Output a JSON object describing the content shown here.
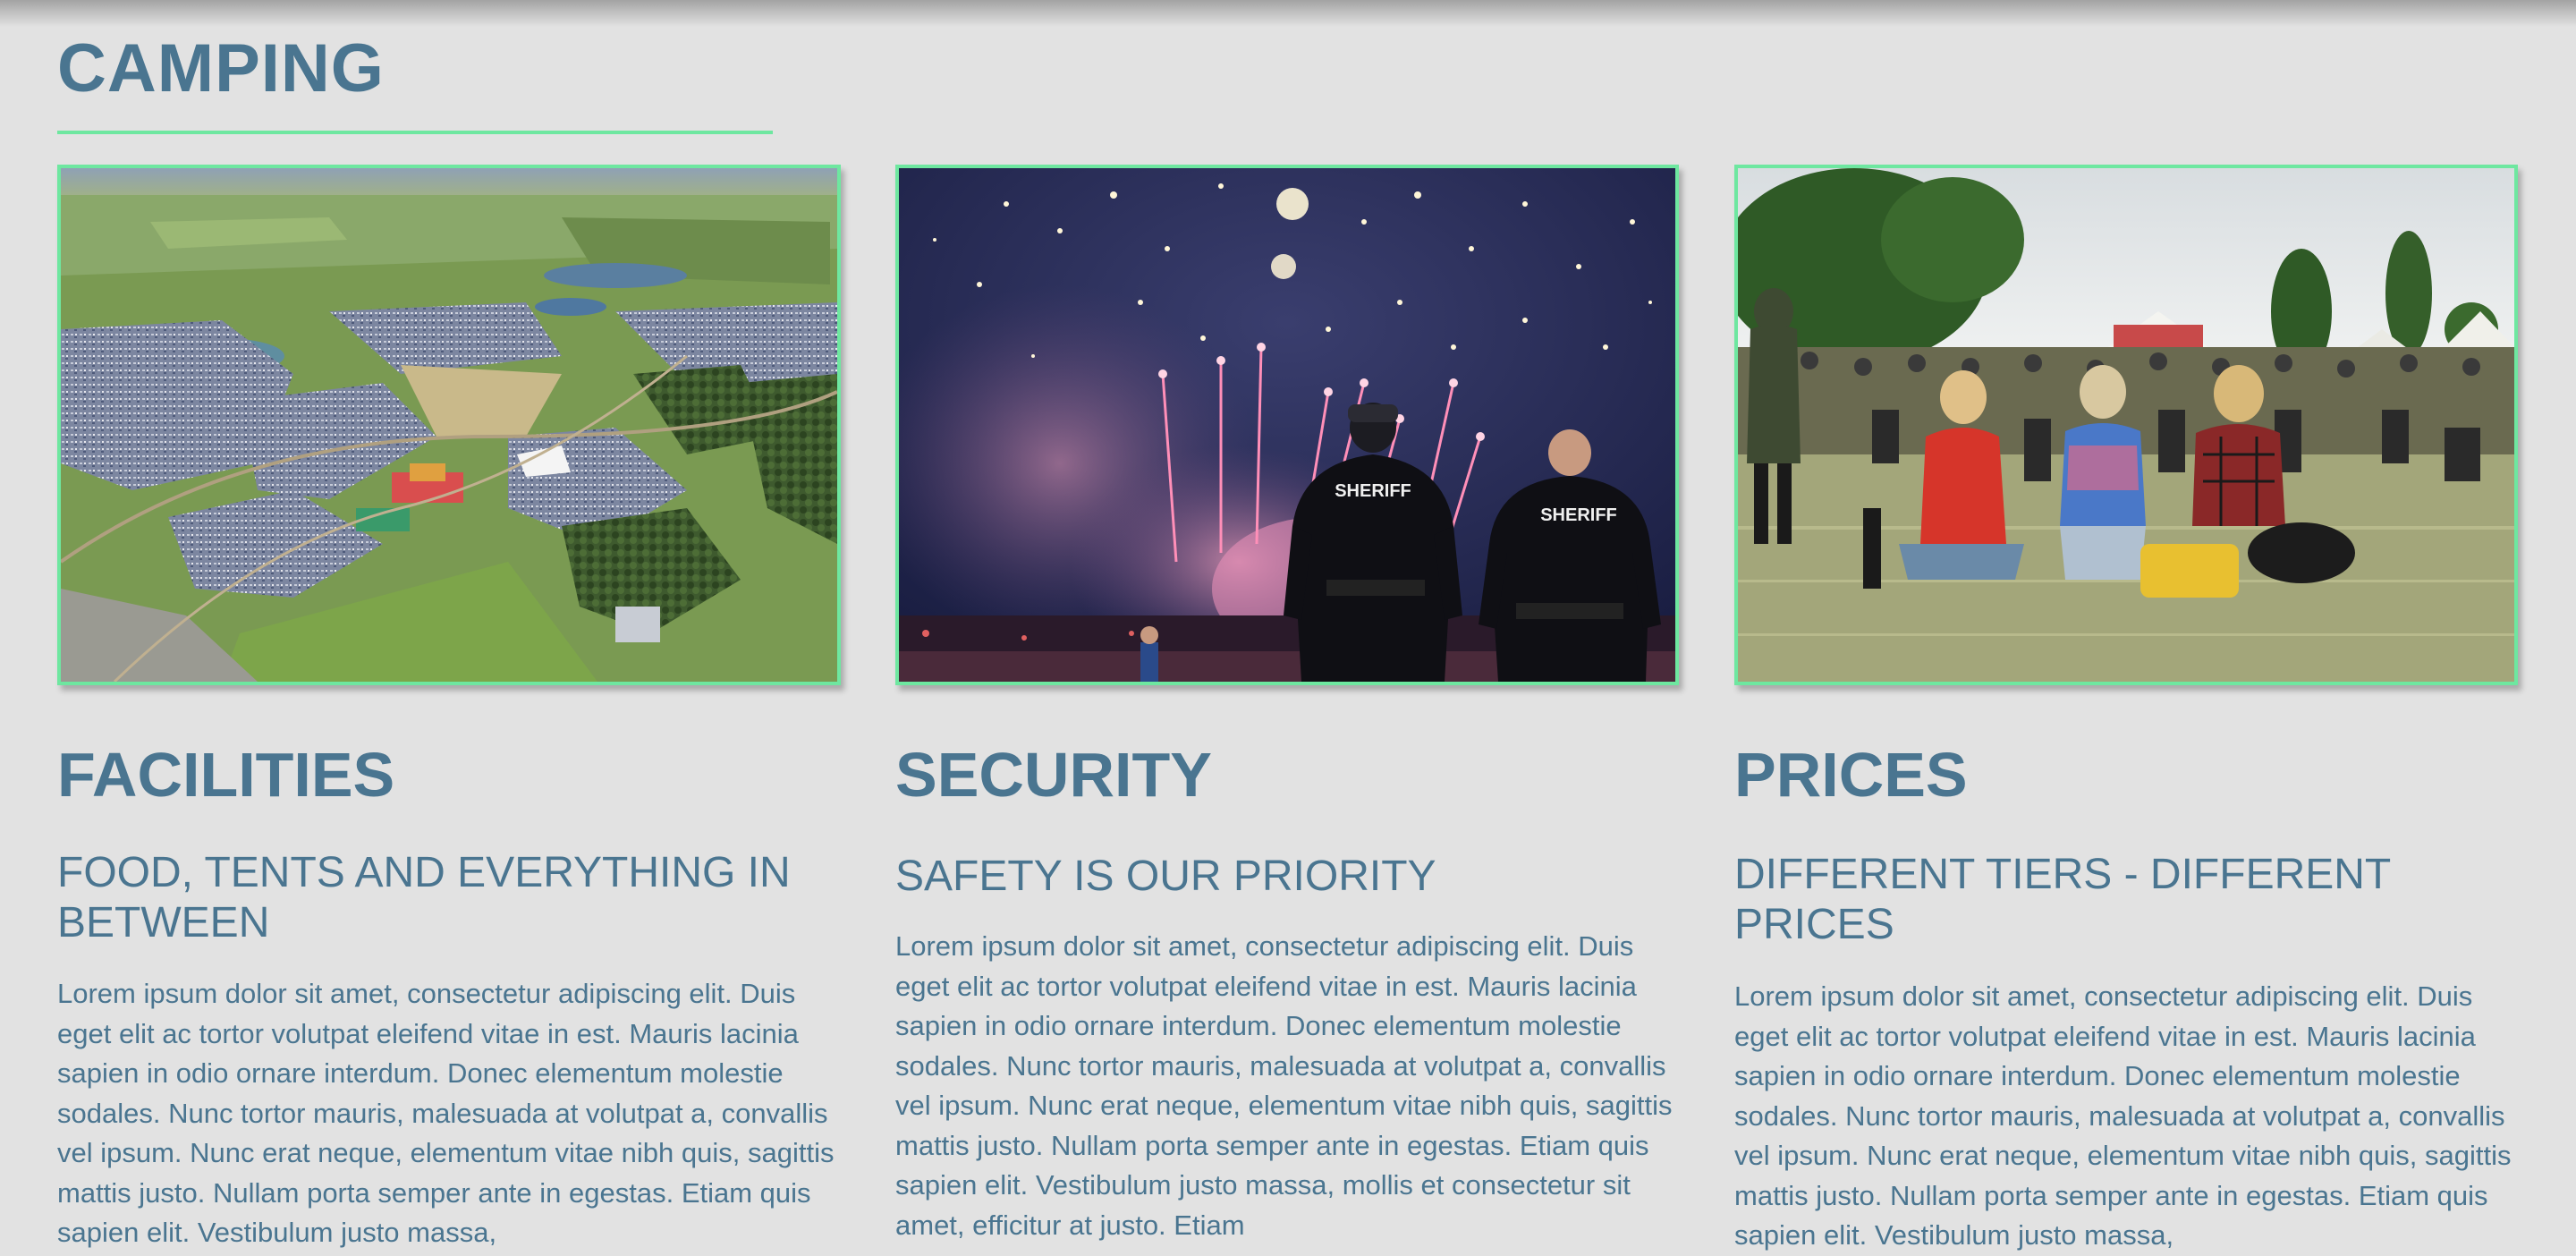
{
  "section": {
    "title": "CAMPING"
  },
  "cards": [
    {
      "image_label": "Aerial view of campsite",
      "heading": "FACILITIES",
      "subheading": "FOOD, TENTS AND EVERYTHING IN BETWEEN",
      "text": "Lorem ipsum dolor sit amet, consectetur adipiscing elit. Duis eget elit ac tortor volutpat eleifend vitae in est. Mauris lacinia sapien in odio ornare interdum. Donec elementum molestie sodales. Nunc tortor mauris, malesuada at volutpat a, convallis vel ipsum. Nunc erat neque, elementum vitae nibh quis, sagittis mattis justo. Nullam porta semper ante in egestas. Etiam quis sapien elit. Vestibulum justo massa,"
    },
    {
      "image_label": "Sheriffs watching fireworks",
      "badge_text": "SHERIFF",
      "heading": "SECURITY",
      "subheading": "SAFETY IS OUR PRIORITY",
      "text": "Lorem ipsum dolor sit amet, consectetur adipiscing elit. Duis eget elit ac tortor volutpat eleifend vitae in est. Mauris lacinia sapien in odio ornare interdum. Donec elementum molestie sodales. Nunc tortor mauris, malesuada at volutpat a, convallis vel ipsum. Nunc erat neque, elementum vitae nibh quis, sagittis mattis justo. Nullam porta semper ante in egestas. Etiam quis sapien elit. Vestibulum justo massa, mollis et consectetur sit amet, efficitur at justo. Etiam"
    },
    {
      "image_label": "Festival crowd on grass",
      "heading": "PRICES",
      "subheading": "DIFFERENT TIERS - DIFFERENT PRICES",
      "text": "Lorem ipsum dolor sit amet, consectetur adipiscing elit. Duis eget elit ac tortor volutpat eleifend vitae in est. Mauris lacinia sapien in odio ornare interdum. Donec elementum molestie sodales. Nunc tortor mauris, malesuada at volutpat a, convallis vel ipsum. Nunc erat neque, elementum vitae nibh quis, sagittis mattis justo. Nullam porta semper ante in egestas. Etiam quis sapien elit. Vestibulum justo massa,"
    }
  ],
  "colors": {
    "accent": "#6ee7a0",
    "text": "#4a7590",
    "background": "#e2e2e2"
  }
}
